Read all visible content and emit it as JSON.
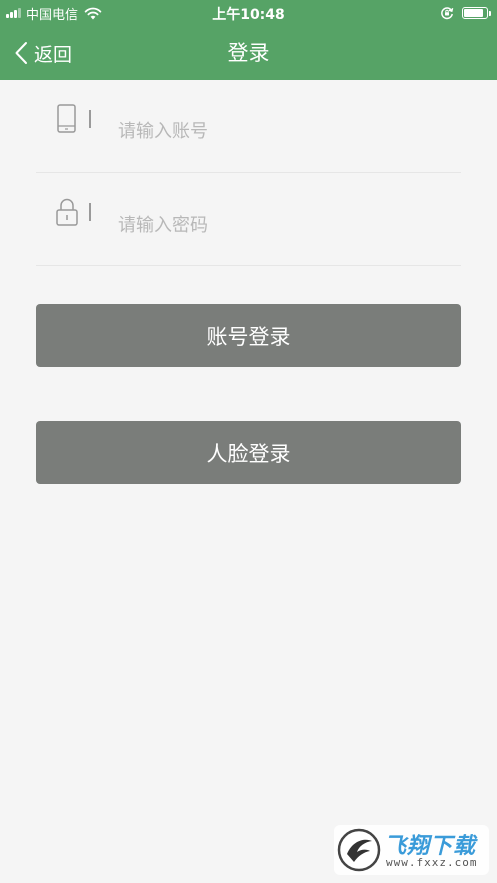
{
  "status_bar": {
    "carrier": "中国电信",
    "time": "上午10:48",
    "battery_level": 0.95
  },
  "nav": {
    "back_label": "返回",
    "title": "登录"
  },
  "form": {
    "account_placeholder": "请输入账号",
    "password_placeholder": "请输入密码"
  },
  "buttons": {
    "account_login": "账号登录",
    "face_login": "人脸登录"
  },
  "watermark": {
    "brand": "飞翔下载",
    "url": "www.fxxz.com"
  },
  "colors": {
    "header": "#56a366",
    "button": "#7a7d7a",
    "background": "#f5f5f5"
  }
}
